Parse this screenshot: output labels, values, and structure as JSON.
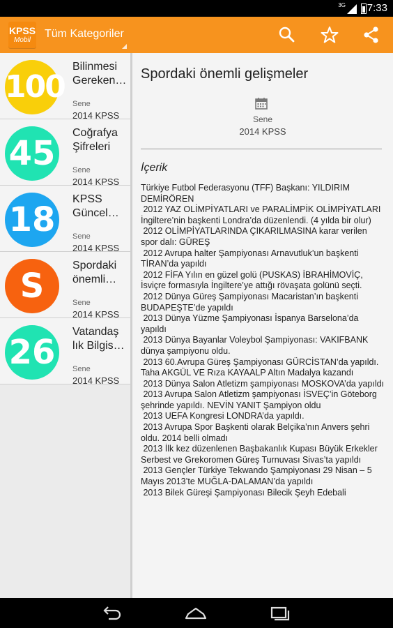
{
  "status_bar": {
    "time": "7:33",
    "network": "3G"
  },
  "action_bar": {
    "logo": {
      "line1": "KPSS",
      "line2": "Mobil"
    },
    "category_spinner": "Tüm Kategoriler",
    "icons": [
      "search-icon",
      "star-icon",
      "share-icon"
    ],
    "color": "#f7931e"
  },
  "list": {
    "items": [
      {
        "badge": "100",
        "color": "#f9cf0a",
        "title_line1": "Bilinmesi",
        "title_line2": "Gereken…",
        "label": "Sene",
        "value": "2014 KPSS"
      },
      {
        "badge": "45",
        "color": "#20e3b2",
        "title_line1": "Coğrafya",
        "title_line2": "Şifreleri",
        "label": "Sene",
        "value": "2014 KPSS"
      },
      {
        "badge": "18",
        "color": "#1da6f0",
        "title_line1": "KPSS",
        "title_line2": "Güncel…",
        "label": "Sene",
        "value": "2014 KPSS"
      },
      {
        "badge": "S",
        "color": "#f7620f",
        "title_line1": "Spordaki",
        "title_line2": "önemli…",
        "label": "Sene",
        "value": "2014 KPSS"
      },
      {
        "badge": "26",
        "color": "#20e3b2",
        "title_line1": "Vatandaş",
        "title_line2": "lık Bilgis…",
        "label": "Sene",
        "value": "2014 KPSS"
      }
    ]
  },
  "detail": {
    "title": "Spordaki önemli gelişmeler",
    "meta_label": "Sene",
    "meta_value": "2014 KPSS",
    "section_heading": "İçerik",
    "paragraphs": [
      "Türkiye Futbol Federasyonu (TFF) Başkanı: YILDIRIM DEMİRÖREN",
      " 2012 YAZ OLİMPİYATLARI ve PARALİMPİK OLİMPİYATLARI İngiltere’nin başkenti Londra’da düzenlendi. (4 yılda bir olur)",
      " 2012 OLİMPİYATLARINDA ÇIKARILMASINA karar verilen spor dalı: GÜREŞ",
      " 2012 Avrupa halter Şampiyonası Arnavutluk’un başkenti TİRAN’da yapıldı",
      " 2012 FİFA Yılın en güzel golü (PUSKAS) İBRAHİMOVİÇ, İsviçre formasıyla İngiltere’ye attığı rövaşata golünü seçti.",
      " 2012 Dünya Güreş Şampiyonası Macaristan’ın başkenti BUDAPEŞTE’de yapıldı",
      " 2013 Dünya Yüzme Şampiyonası İspanya Barselona’da yapıldı",
      " 2013 Dünya Bayanlar Voleybol Şampiyonası: VAKIFBANK dünya şampiyonu oldu.",
      " 2013 60.Avrupa Güreş Şampiyonası GÜRCİSTAN’da yapıldı. Taha AKGÜL VE Rıza KAYAALP Altın Madalya kazandı",
      " 2013 Dünya Salon Atletizm şampiyonası MOSKOVA’da yapıldı",
      " 2013 Avrupa Salon Atletizm şampiyonası İSVEÇ’in Göteborg şehrinde yapıldı. NEVİN YANIT Şampiyon oldu",
      " 2013 UEFA Kongresi LONDRA’da yapıldı.",
      " 2013 Avrupa Spor Başkenti olarak Belçika’nın Anvers şehri oldu. 2014 belli olmadı",
      " 2013 İlk kez düzenlenen Başbakanlık Kupası Büyük Erkekler Serbest ve Grekoromen Güreş Turnuvası Sivas’ta yapıldı",
      " 2013 Gençler Türkiye Tekwando Şampiyonası 29 Nisan – 5 Mayıs 2013’te MUĞLA-DALAMAN’da yapıldı",
      " 2013 Bilek Güreşi Şampiyonası Bilecik Şeyh Edebali"
    ]
  },
  "nav_bar": {
    "icons": [
      "back-icon",
      "home-icon",
      "recents-icon"
    ]
  }
}
